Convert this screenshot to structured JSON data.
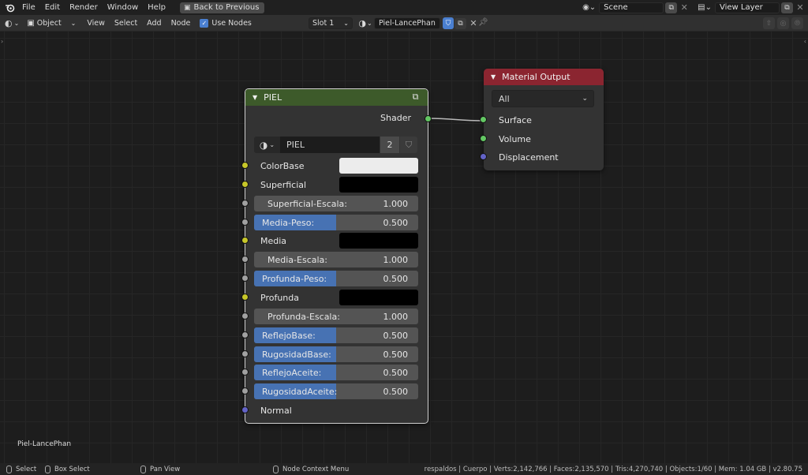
{
  "topbar": {
    "menus": [
      "File",
      "Edit",
      "Render",
      "Window",
      "Help"
    ],
    "back_button": "Back to Previous",
    "scene": "Scene",
    "view_layer": "View Layer"
  },
  "editor_header": {
    "mode": "Object",
    "menus": [
      "View",
      "Select",
      "Add",
      "Node"
    ],
    "use_nodes_label": "Use Nodes",
    "use_nodes_checked": true,
    "slot": "Slot 1",
    "material_name": "Piel-LancePhan"
  },
  "piel_node": {
    "title": "PIEL",
    "header_color": "#3d5a2a",
    "output_label": "Shader",
    "node_group_name": "PIEL",
    "users_count": "2",
    "inputs": [
      {
        "kind": "color",
        "label": "ColorBase",
        "socket": "yellow",
        "swatch": "white"
      },
      {
        "kind": "color",
        "label": "Superficial",
        "socket": "yellow",
        "swatch": "black"
      },
      {
        "kind": "value",
        "label": "Superficial-Escala:",
        "value": "1.000",
        "fill": 0.0,
        "socket": "grey"
      },
      {
        "kind": "value",
        "label": "Media-Peso:",
        "value": "0.500",
        "fill": 0.5,
        "socket": "grey"
      },
      {
        "kind": "color",
        "label": "Media",
        "socket": "yellow",
        "swatch": "black"
      },
      {
        "kind": "value",
        "label": "Media-Escala:",
        "value": "1.000",
        "fill": 0.0,
        "socket": "grey"
      },
      {
        "kind": "value",
        "label": "Profunda-Peso:",
        "value": "0.500",
        "fill": 0.5,
        "socket": "grey"
      },
      {
        "kind": "color",
        "label": "Profunda",
        "socket": "yellow",
        "swatch": "black"
      },
      {
        "kind": "value",
        "label": "Profunda-Escala:",
        "value": "1.000",
        "fill": 0.0,
        "socket": "grey"
      },
      {
        "kind": "value",
        "label": "ReflejoBase:",
        "value": "0.500",
        "fill": 0.5,
        "socket": "grey"
      },
      {
        "kind": "value",
        "label": "RugosidadBase:",
        "value": "0.500",
        "fill": 0.5,
        "socket": "grey"
      },
      {
        "kind": "value",
        "label": "ReflejoAceite:",
        "value": "0.500",
        "fill": 0.5,
        "socket": "grey"
      },
      {
        "kind": "value",
        "label": "RugosidadAceite:",
        "value": "0.500",
        "fill": 0.5,
        "socket": "grey"
      },
      {
        "kind": "vector",
        "label": "Normal",
        "socket": "blue"
      }
    ]
  },
  "output_node": {
    "title": "Material Output",
    "header_color": "#8b2530",
    "target": "All",
    "inputs": [
      {
        "label": "Surface",
        "socket": "green"
      },
      {
        "label": "Volume",
        "socket": "green"
      },
      {
        "label": "Displacement",
        "socket": "blue"
      }
    ]
  },
  "canvas": {
    "material_label": "Piel-LancePhan"
  },
  "statusbar": {
    "select": "Select",
    "box_select": "Box Select",
    "pan_view": "Pan View",
    "context_menu": "Node Context Menu",
    "stats": "respaldos | Cuerpo | Verts:2,142,766 | Faces:2,135,570 | Tris:4,270,740 | Objects:1/60 | Mem: 1.04 GB | v2.80.75"
  },
  "colors": {
    "socket_yellow": "#c7c729",
    "socket_grey": "#a1a1a1",
    "socket_blue": "#6363c7",
    "socket_green": "#63c763",
    "slider_fill": "#4772b3"
  }
}
